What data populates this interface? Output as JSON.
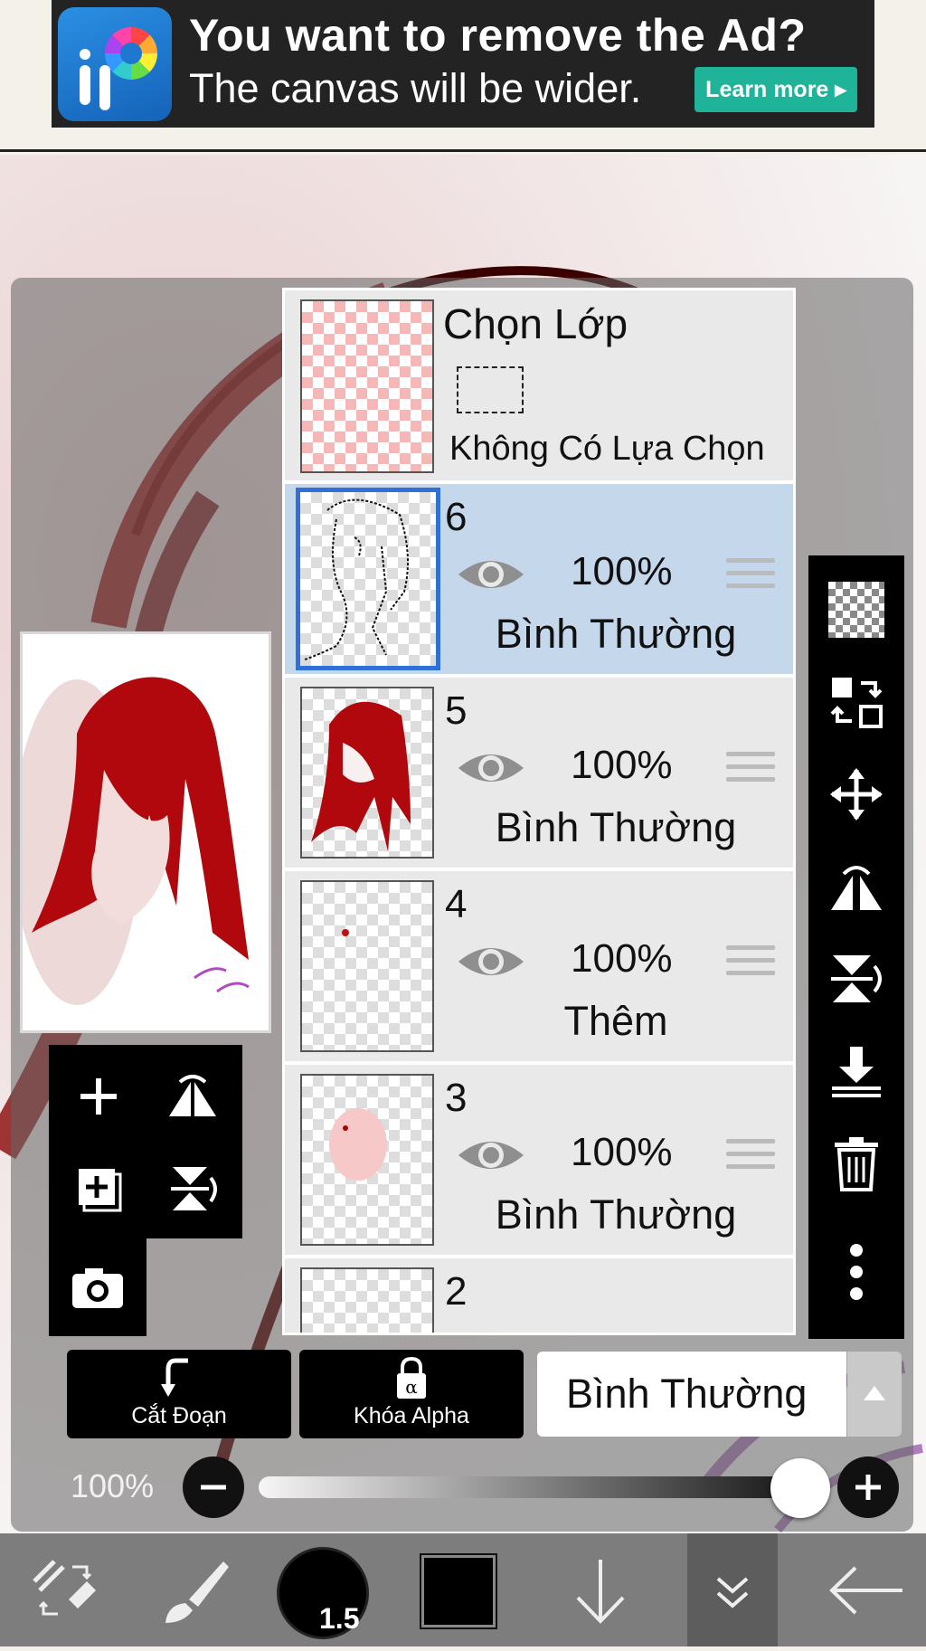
{
  "ad": {
    "title": "You want to remove the Ad?",
    "subtitle": "The canvas will be wider.",
    "button_label": "Learn more ▸",
    "brand_color": "#1fb39a",
    "logo_icon": "ibispaint-logo"
  },
  "selection_layer": {
    "title": "Chọn Lớp",
    "status": "Không Có Lựa Chọn"
  },
  "layers": [
    {
      "number": "6",
      "opacity": "100%",
      "blend": "Bình Thường",
      "selected": true,
      "visible": true
    },
    {
      "number": "5",
      "opacity": "100%",
      "blend": "Bình Thường",
      "selected": false,
      "visible": true
    },
    {
      "number": "4",
      "opacity": "100%",
      "blend": "Thêm",
      "selected": false,
      "visible": true
    },
    {
      "number": "3",
      "opacity": "100%",
      "blend": "Bình Thường",
      "selected": false,
      "visible": true
    },
    {
      "number": "2"
    }
  ],
  "right_toolbar": [
    "transparent-layer-icon",
    "swap-layer-icon",
    "move-icon",
    "flip-horizontal-icon",
    "flip-vertical-icon",
    "merge-down-icon",
    "trash-icon",
    "more-vertical-icon"
  ],
  "left_tools": [
    "add-layer-icon",
    "flip-h-icon",
    "duplicate-layer-icon",
    "flip-v-icon",
    "camera-icon"
  ],
  "controls": {
    "clip_label": "Cắt Đoạn",
    "alpha_lock_label": "Khóa Alpha",
    "blend_mode": "Bình Thường",
    "opacity_label": "100%",
    "opacity_value": 1.0
  },
  "bottom_toolbar": {
    "brush_size": "1.5",
    "current_color": "#000000"
  },
  "colors": {
    "selected_row": "#c5d7ea",
    "selected_border": "#2e6fd8",
    "hair_red": "#b0080c"
  }
}
